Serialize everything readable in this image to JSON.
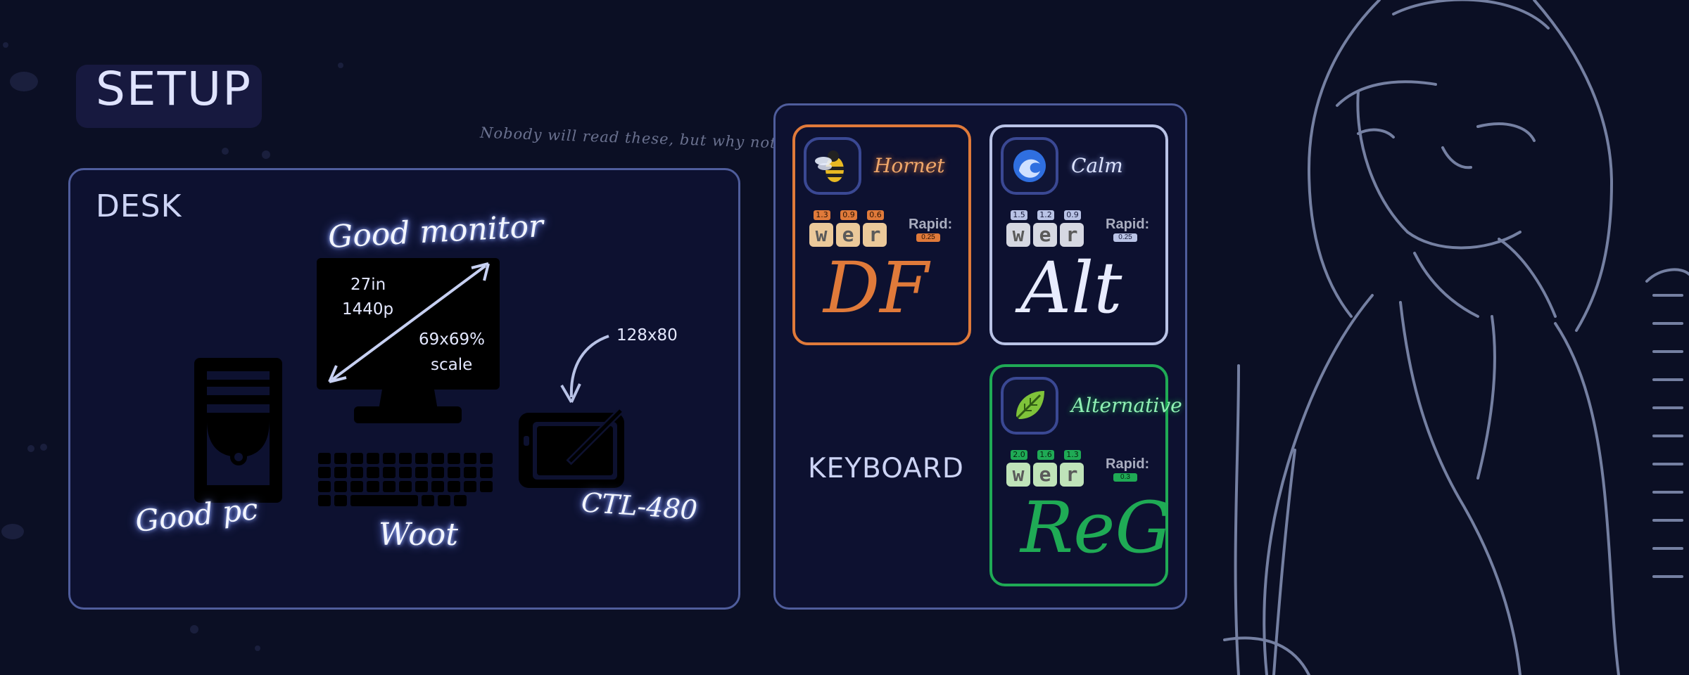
{
  "header": {
    "title": "SETUP"
  },
  "note": "Nobody will read these, but why not",
  "desk": {
    "title": "DESK",
    "monitor_label": "Good monitor",
    "monitor_size": "27in",
    "monitor_res": "1440p",
    "monitor_scale": "69x69%",
    "monitor_scale_word": "scale",
    "pc_label": "Good pc",
    "keyboard_label": "Woot",
    "tablet_label": "CTL-480",
    "tablet_res": "128x80"
  },
  "keyboard": {
    "title": "KEYBOARD",
    "rapid_label": "Rapid:",
    "cards": [
      {
        "name": "Hornet",
        "color": "#e07a3a",
        "icon": "bee-icon",
        "keys": [
          "w",
          "e",
          "r"
        ],
        "values": [
          "1.3",
          "0.9",
          "0.6"
        ],
        "rapid": "0.25",
        "signature": "DF",
        "key_color": "#ebc99a"
      },
      {
        "name": "Calm",
        "color": "#b9c3e6",
        "icon": "wave-icon",
        "keys": [
          "w",
          "e",
          "r"
        ],
        "values": [
          "1.5",
          "1.2",
          "0.9"
        ],
        "rapid": "0.25",
        "signature": "Alt",
        "key_color": "#d6d8e2"
      },
      {
        "name": "Alternative",
        "color": "#1faa55",
        "icon": "leaf-icon",
        "keys": [
          "w",
          "e",
          "r"
        ],
        "values": [
          "2.0",
          "1.6",
          "1.3"
        ],
        "rapid": "0.3",
        "signature": "ReG",
        "key_color": "#bfe3b9"
      }
    ]
  }
}
